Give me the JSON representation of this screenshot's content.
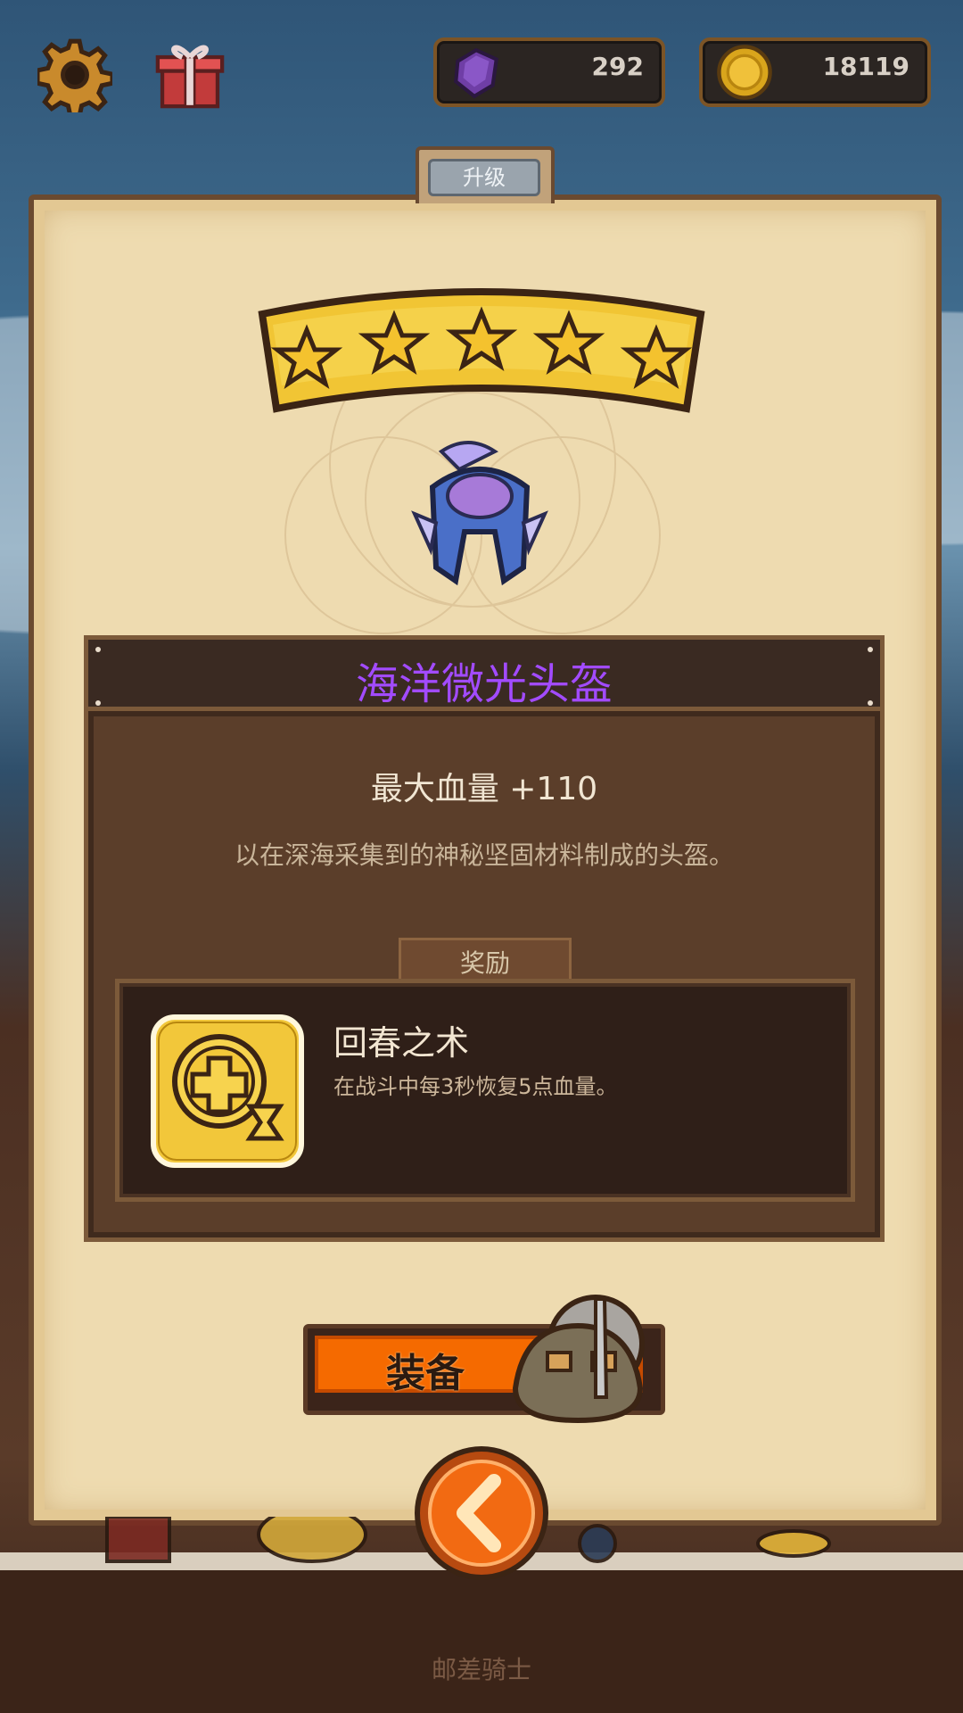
{
  "currency": {
    "gems": "292",
    "coins": "18119"
  },
  "panel": {
    "tab_label": "升级",
    "stars": 5,
    "item_name": "海洋微光头盔",
    "stat_line": "最大血量 +110",
    "description": "以在深海采集到的神秘坚固材料制成的头盔。",
    "reward_tab_label": "奖励",
    "reward": {
      "title": "回春之术",
      "description": "在战斗中每3秒恢复5点血量。"
    },
    "equip_label": "装备"
  },
  "footer": {
    "hero_name": "邮差骑士"
  },
  "colors": {
    "item_name": "#a24bff",
    "equip_button": "#f56a00",
    "panel_bg": "#eedbb0"
  }
}
